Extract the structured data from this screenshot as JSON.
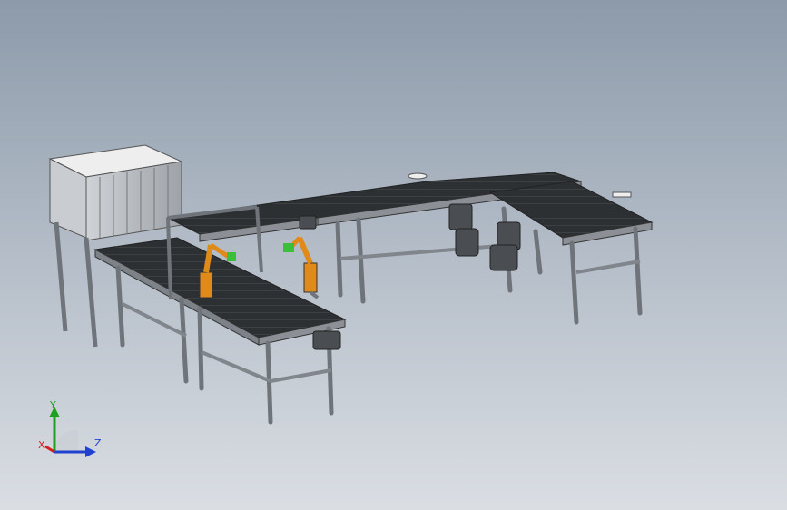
{
  "viewport": {
    "background_top": "#8c9aaa",
    "background_bottom": "#dadee3"
  },
  "model": {
    "frame_color": "#6f747a",
    "belt_color": "#2d3033",
    "hood_color": "#e6e6e6",
    "robot_arm_color": "#e08a1a",
    "gripper_color": "#3bbf3b",
    "motor_color": "#4a4e53"
  },
  "triad": {
    "x_label": "X",
    "y_label": "Y",
    "z_label": "Z",
    "x_color": "#d42020",
    "y_color": "#20a020",
    "z_color": "#2040d0"
  }
}
